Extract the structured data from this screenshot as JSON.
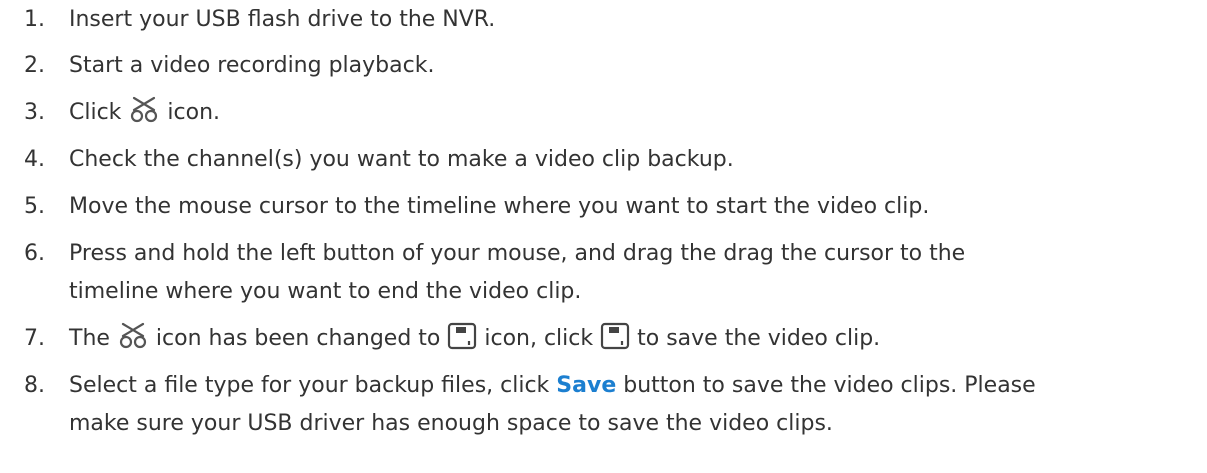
{
  "steps": [
    {
      "number": "1.",
      "text": "Insert your USB flash drive to the NVR."
    },
    {
      "number": "2.",
      "text": "Start a video recording playback."
    },
    {
      "number": "3.",
      "pre": "Click ",
      "post": " icon.",
      "icon": "scissors-icon"
    },
    {
      "number": "4.",
      "text": "Check the channel(s) you want to make a video clip backup."
    },
    {
      "number": "5.",
      "text": "Move the mouse cursor to the timeline where you want to start the video clip."
    },
    {
      "number": "6.",
      "line1": "Press and hold the left button of your mouse, and drag the drag the cursor to the",
      "line2": "timeline where you want to end the video clip."
    },
    {
      "number": "7.",
      "part1": "The ",
      "part2": " icon has been changed to ",
      "part3": " icon, click ",
      "part4": " to save the video clip.",
      "icons": [
        "scissors-icon",
        "save-icon",
        "save-icon"
      ]
    },
    {
      "number": "8.",
      "pre": "Select a file type for your backup files, click ",
      "bold": "Save",
      "post": " button to save the video clips. Please",
      "line2": "make sure your USB driver has enough space to save the video clips."
    }
  ],
  "colors": {
    "text": "#333333",
    "link": "#1c7fd0",
    "icon_stroke": "#555555"
  }
}
